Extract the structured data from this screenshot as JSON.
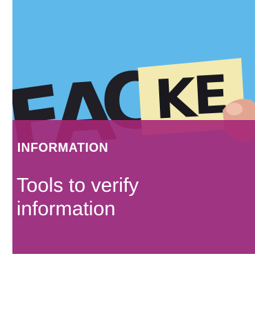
{
  "card": {
    "category": "INFORMATION",
    "title": "Tools to verify information",
    "image": {
      "icon": "fake-fact-photo",
      "letters": [
        "F",
        "A",
        "C",
        "K",
        "E"
      ]
    }
  },
  "colors": {
    "overlay": "#a62678",
    "sky": "#5fb8ea",
    "paper": "#f2eab0",
    "text": "#ffffff"
  }
}
